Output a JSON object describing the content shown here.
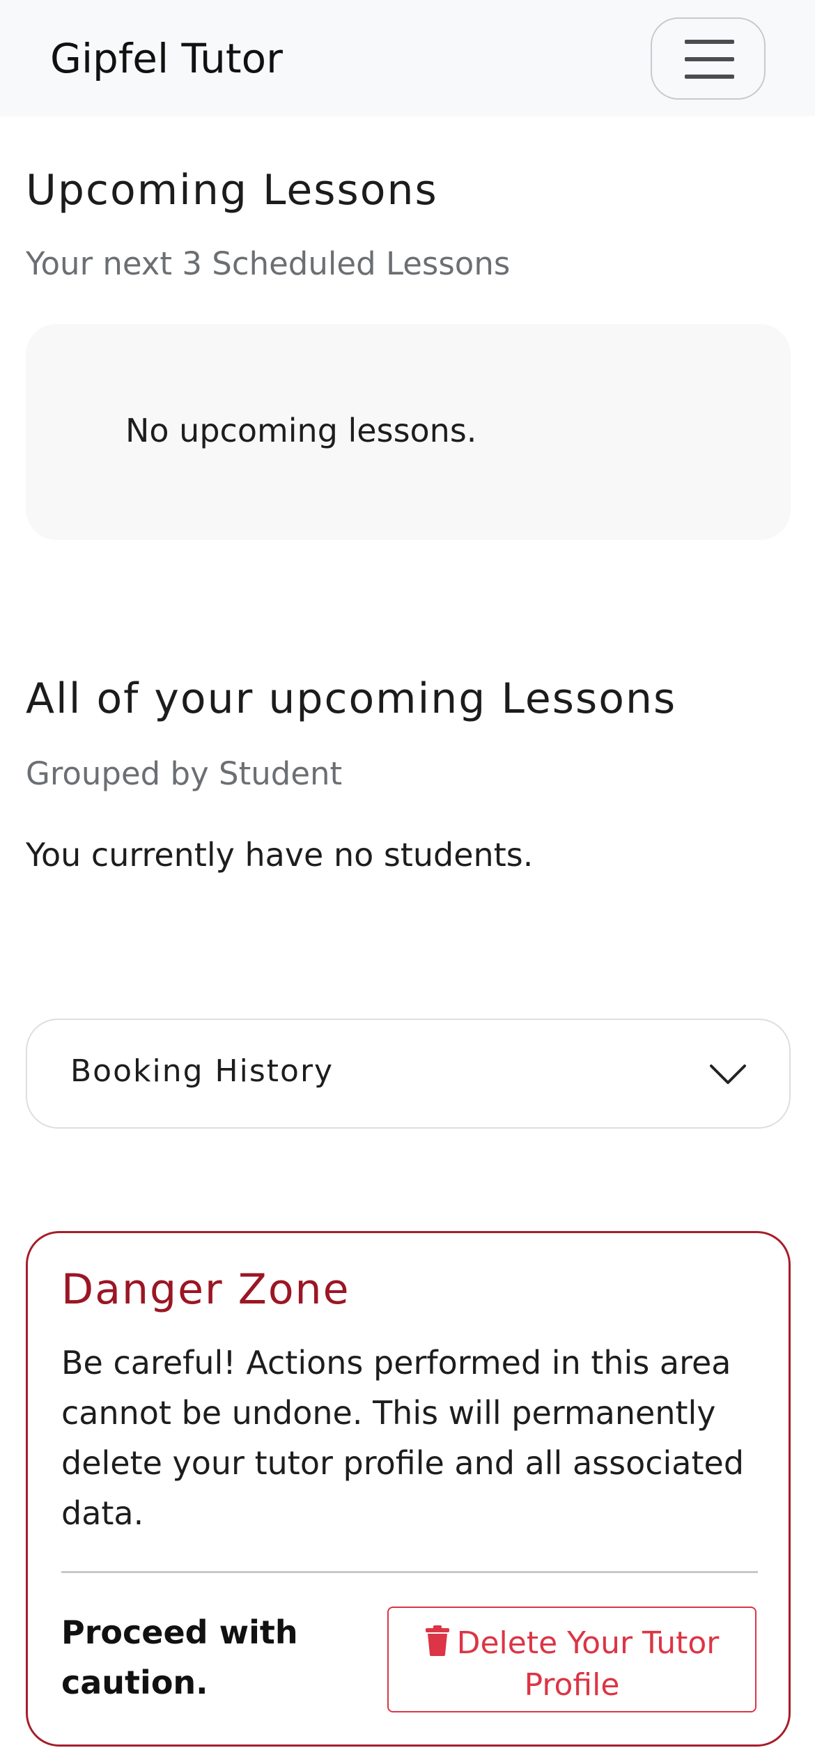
{
  "navbar": {
    "brand": "Gipfel Tutor",
    "menu_icon": "hamburger-menu-icon"
  },
  "upcoming": {
    "title": "Upcoming Lessons",
    "subtitle": "Your next 3 Scheduled Lessons",
    "empty_message": "No upcoming lessons."
  },
  "all_upcoming": {
    "title": "All of your upcoming Lessons",
    "subtitle": "Grouped by Student",
    "empty_message": "You currently have no students."
  },
  "booking_history": {
    "label": "Booking History",
    "chevron_icon": "chevron-down-icon"
  },
  "danger_zone": {
    "title": "Danger Zone",
    "description": "Be careful! Actions performed in this area cannot be undone. This will permanently delete your tutor profile and all associated data.",
    "caution": "Proceed with caution.",
    "delete_button_label": "Delete Your Tutor Profile",
    "delete_icon": "trash-icon",
    "accent_color": "#a71d2a",
    "button_color": "#dc3545"
  }
}
